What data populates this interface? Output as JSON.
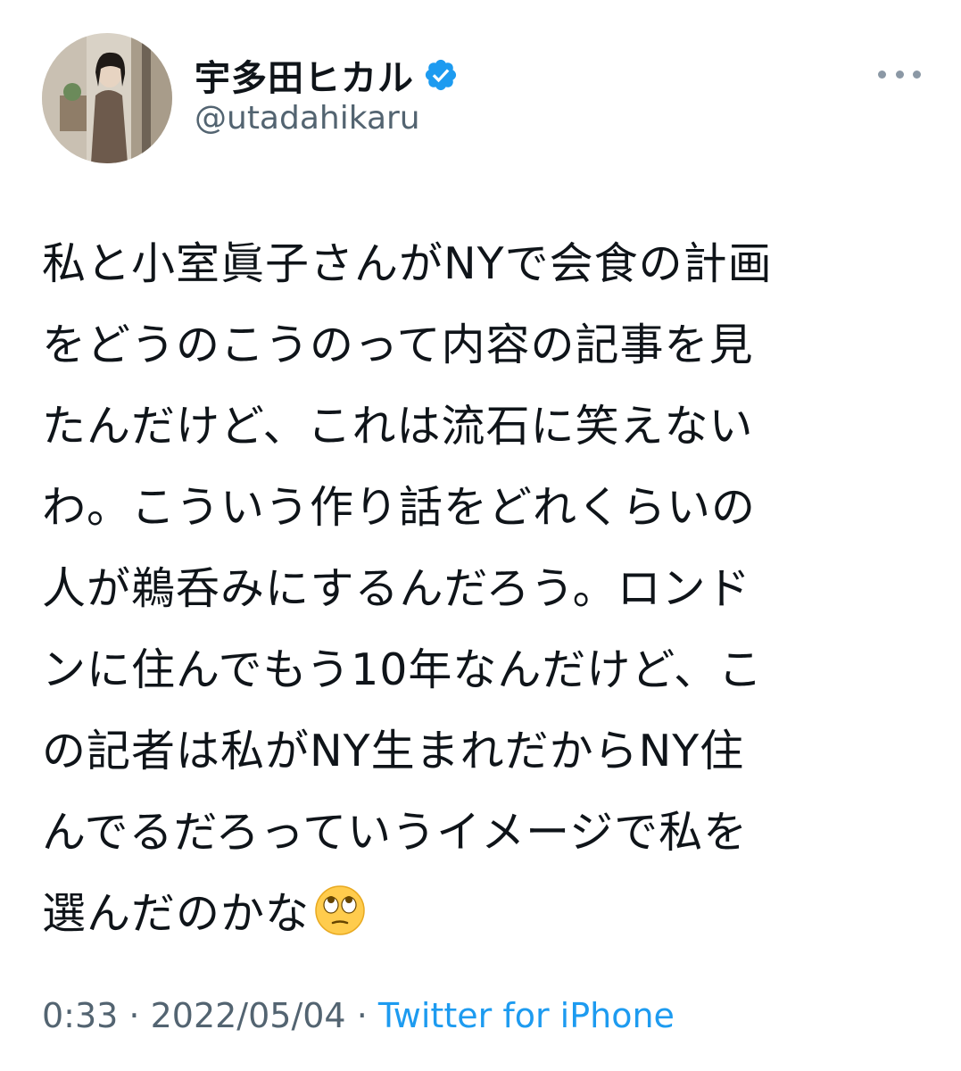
{
  "author": {
    "display_name": "宇多田ヒカル",
    "handle": "@utadahikaru",
    "verified": true,
    "avatar_icon": "profile-photo"
  },
  "menu_icon": "more-options-icon",
  "tweet": {
    "lines": [
      "私と小室眞子さんがNYで会食の計画",
      "をどうのこうのって内容の記事を見",
      "たんだけど、これは流石に笑えない",
      "わ。こういう作り話をどれくらいの",
      "人が鵜呑みにするんだろう。ロンド",
      "ンに住んでもう10年なんだけど、こ",
      "の記者は私がNY生まれだからNY住",
      "んでるだろっていうイメージで私を",
      "選んだのかな"
    ],
    "emoji": "🙄"
  },
  "meta": {
    "time": "0:33",
    "separator_1": " · ",
    "date": "2022/05/04",
    "separator_2": " · ",
    "source": "Twitter for iPhone"
  },
  "colors": {
    "text": "#0f1419",
    "secondary": "#536471",
    "link": "#1d9bf0",
    "verified_badge": "#1d9bf0"
  }
}
